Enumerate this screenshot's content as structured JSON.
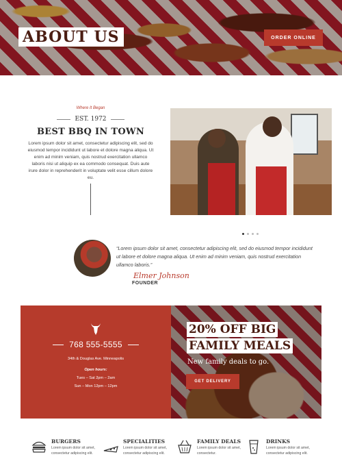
{
  "hero": {
    "title": "ABOUT US",
    "order_button": "ORDER ONLINE"
  },
  "about": {
    "kicker": "Where It Began",
    "established": "EST. 1972",
    "heading": "BEST BBQ IN TOWN",
    "body": "Lorem ipsum dolor sit amet, consectetur adipiscing elit, sed do eiusmod tempor incididunt ut labore et dolore magna aliqua. Ut enim ad minim veniam, quis nostrud exercitation ullamco laboris nisi ut aliquip ex ea commodo consequat. Duis aute irure dolor in reprehenderit in voluptate velit esse cillum dolore eu."
  },
  "testimonial": {
    "quote": "“Lorem ipsum dolor sit amet, consectetur adipiscing elit, sed do eiusmod tempor incididunt ut labore et dolore magna aliqua. Ut enim ad minim veniam, quis nostrud exercitation ullamco laboris.”",
    "signature": "Elmer Johnson",
    "role": "FOUNDER"
  },
  "contact": {
    "phone": "768 555-5555",
    "address": "34th & Douglas Ave. Minneapolis",
    "hours_label": "Open hours:",
    "hours": [
      "Tues – Sat  2pm – 2am",
      "Sun –  Mon 12pm – 12pm"
    ]
  },
  "promo": {
    "line1": "20% OFF BIG",
    "line2": "FAMILY MEALS",
    "subtitle": "New family deals to go.",
    "button": "GET DELIVERY"
  },
  "categories": [
    {
      "title": "BURGERS",
      "desc": "Lorem ipsum dolor sit amet, consectetur adipiscing elit.",
      "icon": "burger-icon"
    },
    {
      "title": "SPECIALITIES",
      "desc": "Lorem ipsum dolor sit amet, consectetur adipiscing elit.",
      "icon": "pizza-icon"
    },
    {
      "title": "FAMILY DEALS",
      "desc": "Lorem ipsum dolor sit amet, consectetur.",
      "icon": "basket-icon"
    },
    {
      "title": "DRINKS",
      "desc": "Lorem ipsum dolor sit amet, consectetur adipiscing elit.",
      "icon": "drink-icon"
    }
  ],
  "colors": {
    "accent": "#b83a2c",
    "heading_dark": "#4a1d12"
  }
}
